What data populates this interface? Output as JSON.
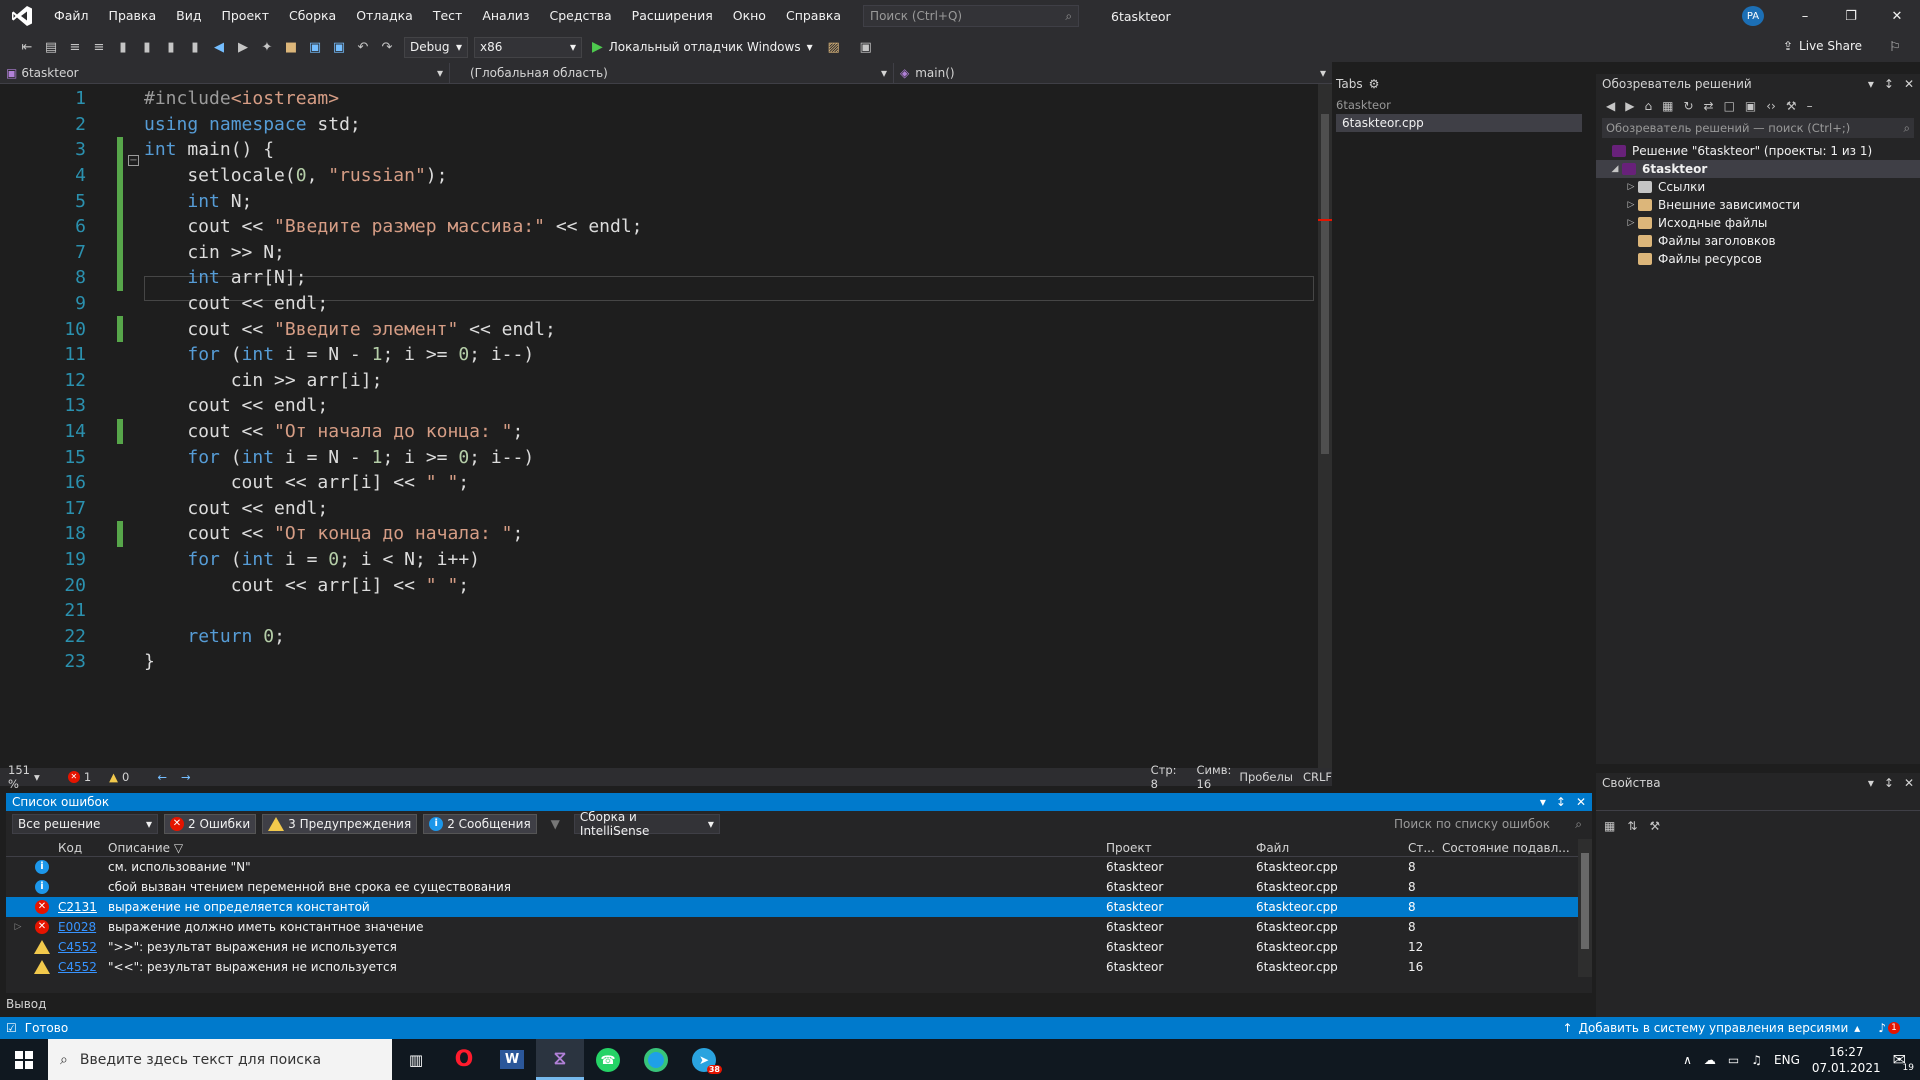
{
  "window": {
    "solution_title": "6taskteor",
    "avatar_initials": "PA"
  },
  "menu": [
    "Файл",
    "Правка",
    "Вид",
    "Проект",
    "Сборка",
    "Отладка",
    "Тест",
    "Анализ",
    "Средства",
    "Расширения",
    "Окно",
    "Справка"
  ],
  "search": {
    "placeholder": "Поиск (Ctrl+Q)"
  },
  "toolbar": {
    "configuration": "Debug",
    "platform": "x86",
    "start_label": "Локальный отладчик Windows",
    "live_share": "Live Share"
  },
  "navbar": {
    "project": "6taskteor",
    "scope": "(Глобальная область)",
    "member": "main()"
  },
  "editor": {
    "zoom": "151 %",
    "error_count": "1",
    "warning_count": "0",
    "line_pos": "Стр: 8",
    "col_pos": "Симв: 16",
    "whitespace": "Пробелы",
    "line_ending": "CRLF",
    "lines": [
      {
        "n": "1",
        "text": "#include<iostream>"
      },
      {
        "n": "2",
        "text": "using namespace std;"
      },
      {
        "n": "3",
        "text": "int main() {"
      },
      {
        "n": "4",
        "text": "    setlocale(0, \"russian\");"
      },
      {
        "n": "5",
        "text": "    int N;"
      },
      {
        "n": "6",
        "text": "    cout << \"Введите размер массива:\" << endl;"
      },
      {
        "n": "7",
        "text": "    cin >> N;"
      },
      {
        "n": "8",
        "text": "    int arr[N];"
      },
      {
        "n": "9",
        "text": "    cout << endl;"
      },
      {
        "n": "10",
        "text": "    cout << \"Введите элемент\" << endl;"
      },
      {
        "n": "11",
        "text": "    for (int i = N - 1; i >= 0; i--)"
      },
      {
        "n": "12",
        "text": "        cin >> arr[i];"
      },
      {
        "n": "13",
        "text": "    cout << endl;"
      },
      {
        "n": "14",
        "text": "    cout << \"От начала до конца: \";"
      },
      {
        "n": "15",
        "text": "    for (int i = N - 1; i >= 0; i--)"
      },
      {
        "n": "16",
        "text": "        cout << arr[i] << \" \";"
      },
      {
        "n": "17",
        "text": "    cout << endl;"
      },
      {
        "n": "18",
        "text": "    cout << \"От конца до начала: \";"
      },
      {
        "n": "19",
        "text": "    for (int i = 0; i < N; i++)"
      },
      {
        "n": "20",
        "text": "        cout << arr[i] << \" \";"
      },
      {
        "n": "21",
        "text": ""
      },
      {
        "n": "22",
        "text": "    return 0;"
      },
      {
        "n": "23",
        "text": "}"
      }
    ]
  },
  "tabs_panel": {
    "title": "Tabs",
    "group": "6taskteor",
    "file": "6taskteor.cpp"
  },
  "solution_explorer": {
    "title": "Обозреватель решений",
    "search_placeholder": "Обозреватель решений — поиск (Ctrl+;)",
    "solution": "Решение \"6taskteor\" (проекты: 1 из 1)",
    "project": "6taskteor",
    "items": [
      "Ссылки",
      "Внешние зависимости",
      "Исходные файлы",
      "Файлы заголовков",
      "Файлы ресурсов"
    ]
  },
  "properties": {
    "title": "Свойства"
  },
  "error_list": {
    "title": "Список ошибок",
    "scope": "Все решение",
    "errors_filter": "2 Ошибки",
    "warnings_filter": "3 Предупреждения",
    "messages_filter": "2 Сообщения",
    "build_source": "Сборка и IntelliSense",
    "search_placeholder": "Поиск по списку ошибок",
    "columns": [
      "Код",
      "Описание",
      "Проект",
      "Файл",
      "Ст...",
      "Состояние подавл..."
    ],
    "rows": [
      {
        "type": "info",
        "code": "",
        "desc": "см. использование \"N\"",
        "project": "6taskteor",
        "file": "6taskteor.cpp",
        "line": "8"
      },
      {
        "type": "info",
        "code": "",
        "desc": "сбой вызван чтением переменной вне срока ее существования",
        "project": "6taskteor",
        "file": "6taskteor.cpp",
        "line": "8"
      },
      {
        "type": "error",
        "code": "C2131",
        "desc": "выражение не определяется константой",
        "project": "6taskteor",
        "file": "6taskteor.cpp",
        "line": "8"
      },
      {
        "type": "error",
        "code": "E0028",
        "desc": "выражение должно иметь константное значение",
        "project": "6taskteor",
        "file": "6taskteor.cpp",
        "line": "8"
      },
      {
        "type": "warning",
        "code": "C4552",
        "desc": "\">>\": результат выражения не используется",
        "project": "6taskteor",
        "file": "6taskteor.cpp",
        "line": "12"
      },
      {
        "type": "warning",
        "code": "C4552",
        "desc": "\"<<\": результат выражения не используется",
        "project": "6taskteor",
        "file": "6taskteor.cpp",
        "line": "16"
      }
    ]
  },
  "output_tab": "Вывод",
  "statusbar": {
    "ready": "Готово",
    "vcs": "Добавить в систему управления версиями",
    "notifications": "1"
  },
  "taskbar": {
    "search_placeholder": "Введите здесь текст для поиска",
    "lang": "ENG",
    "time": "16:27",
    "date": "07.01.2021",
    "telegram_badge": "38",
    "notif_count": "19"
  }
}
